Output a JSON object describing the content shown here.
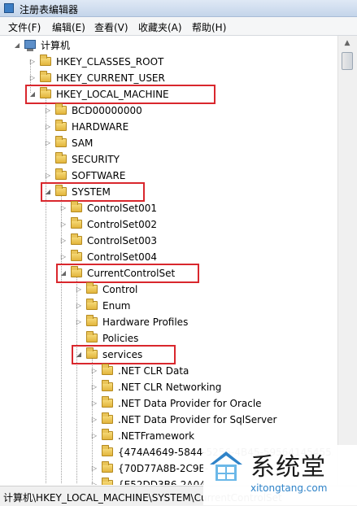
{
  "window": {
    "title": "注册表编辑器"
  },
  "menu": [
    "文件(F)",
    "编辑(E)",
    "查看(V)",
    "收藏夹(A)",
    "帮助(H)"
  ],
  "tree": [
    {
      "label": "计算机",
      "expander": "expanded",
      "icon": "computer-icon",
      "indent": 0
    },
    {
      "label": "HKEY_CLASSES_ROOT",
      "expander": "collapsed",
      "icon": "folder-icon",
      "indent": 1
    },
    {
      "label": "HKEY_CURRENT_USER",
      "expander": "collapsed",
      "icon": "folder-icon",
      "indent": 1
    },
    {
      "label": "HKEY_LOCAL_MACHINE",
      "expander": "expanded",
      "icon": "folder-icon",
      "indent": 1,
      "highlighted": true
    },
    {
      "label": "BCD00000000",
      "expander": "collapsed",
      "icon": "folder-icon",
      "indent": 2
    },
    {
      "label": "HARDWARE",
      "expander": "collapsed",
      "icon": "folder-icon",
      "indent": 2
    },
    {
      "label": "SAM",
      "expander": "collapsed",
      "icon": "folder-icon",
      "indent": 2
    },
    {
      "label": "SECURITY",
      "expander": "none",
      "icon": "folder-icon",
      "indent": 2
    },
    {
      "label": "SOFTWARE",
      "expander": "collapsed",
      "icon": "folder-icon",
      "indent": 2
    },
    {
      "label": "SYSTEM",
      "expander": "expanded",
      "icon": "folder-icon",
      "indent": 2,
      "highlighted": true
    },
    {
      "label": "ControlSet001",
      "expander": "collapsed",
      "icon": "folder-icon",
      "indent": 3
    },
    {
      "label": "ControlSet002",
      "expander": "collapsed",
      "icon": "folder-icon",
      "indent": 3
    },
    {
      "label": "ControlSet003",
      "expander": "collapsed",
      "icon": "folder-icon",
      "indent": 3
    },
    {
      "label": "ControlSet004",
      "expander": "collapsed",
      "icon": "folder-icon",
      "indent": 3
    },
    {
      "label": "CurrentControlSet",
      "expander": "expanded",
      "icon": "folder-icon",
      "indent": 3,
      "highlighted": true
    },
    {
      "label": "Control",
      "expander": "collapsed",
      "icon": "folder-icon",
      "indent": 4
    },
    {
      "label": "Enum",
      "expander": "collapsed",
      "icon": "folder-icon",
      "indent": 4
    },
    {
      "label": "Hardware Profiles",
      "expander": "collapsed",
      "icon": "folder-icon",
      "indent": 4
    },
    {
      "label": "Policies",
      "expander": "none",
      "icon": "folder-icon",
      "indent": 4
    },
    {
      "label": "services",
      "expander": "expanded",
      "icon": "folder-icon",
      "indent": 4,
      "highlighted": true
    },
    {
      "label": ".NET CLR Data",
      "expander": "collapsed",
      "icon": "folder-icon",
      "indent": 5
    },
    {
      "label": ".NET CLR Networking",
      "expander": "collapsed",
      "icon": "folder-icon",
      "indent": 5
    },
    {
      "label": ".NET Data Provider for Oracle",
      "expander": "collapsed",
      "icon": "folder-icon",
      "indent": 5
    },
    {
      "label": ".NET Data Provider for SqlServer",
      "expander": "collapsed",
      "icon": "folder-icon",
      "indent": 5
    },
    {
      "label": ".NETFramework",
      "expander": "collapsed",
      "icon": "folder-icon",
      "indent": 5
    },
    {
      "label": "{474A4649-5844-5256-4B45-595641454555}",
      "expander": "none",
      "icon": "folder-icon",
      "indent": 5
    },
    {
      "label": "{70D77A8B-2C9E-",
      "expander": "collapsed",
      "icon": "folder-icon",
      "indent": 5
    },
    {
      "label": "{E52DD3B6-2A04",
      "expander": "collapsed",
      "icon": "folder-icon",
      "indent": 5
    }
  ],
  "statusbar": {
    "path": "计算机\\HKEY_LOCAL_MACHINE\\SYSTEM\\CurrentControlSet"
  },
  "watermark": {
    "title": "系统堂",
    "url": "xitongtang.com"
  },
  "colors": {
    "highlight_box": "#d9272d",
    "folder": "#e9c458",
    "titlebar": "#c4d5ea"
  }
}
